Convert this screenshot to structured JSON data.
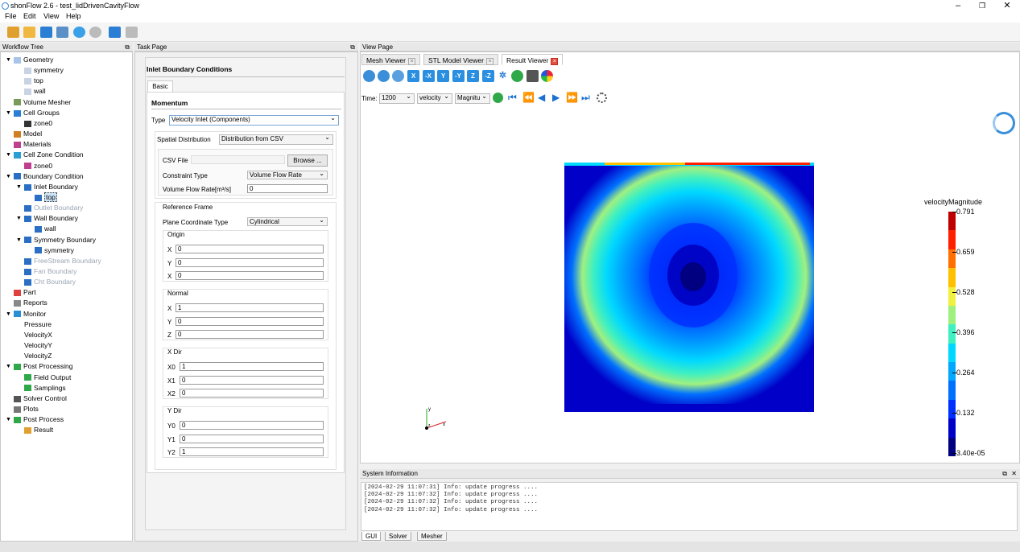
{
  "window": {
    "title": "shonFlow 2.6 - test_lidDrivenCavityFlow",
    "min": "–",
    "max": "❐",
    "close": "✕"
  },
  "menu": [
    "File",
    "Edit",
    "View",
    "Help"
  ],
  "panels": {
    "workflow": "Workflow Tree",
    "task": "Task Page",
    "view": "View Page",
    "sysinfo": "System Information",
    "float_icon": "⧉"
  },
  "tree": [
    {
      "label": "Geometry",
      "icon": "geometry",
      "expanded": true,
      "level": 0
    },
    {
      "label": "symmetry",
      "icon": "file",
      "level": 1
    },
    {
      "label": "top",
      "icon": "file",
      "level": 1
    },
    {
      "label": "wall",
      "icon": "file",
      "level": 1
    },
    {
      "label": "Volume Mesher",
      "icon": "mesher",
      "level": 0
    },
    {
      "label": "Cell Groups",
      "icon": "cellgroups",
      "expanded": true,
      "level": 0
    },
    {
      "label": "zone0",
      "icon": "zone",
      "level": 1
    },
    {
      "label": "Model",
      "icon": "model",
      "level": 0
    },
    {
      "label": "Materials",
      "icon": "materials",
      "level": 0
    },
    {
      "label": "Cell Zone Condition",
      "icon": "cellzone",
      "expanded": true,
      "level": 0
    },
    {
      "label": "zone0",
      "icon": "materials",
      "level": 1
    },
    {
      "label": "Boundary Condition",
      "icon": "boundary",
      "expanded": true,
      "level": 0
    },
    {
      "label": "Inlet Boundary",
      "icon": "boundary",
      "expanded": true,
      "level": 1
    },
    {
      "label": "top",
      "icon": "boundary",
      "level": 2,
      "selected": true
    },
    {
      "label": "Outlet Boundary",
      "icon": "boundary",
      "level": 1,
      "disabled": true
    },
    {
      "label": "Wall Boundary",
      "icon": "boundary",
      "expanded": true,
      "level": 1
    },
    {
      "label": "wall",
      "icon": "boundary",
      "level": 2
    },
    {
      "label": "Symmetry Boundary",
      "icon": "boundary",
      "expanded": true,
      "level": 1
    },
    {
      "label": "symmetry",
      "icon": "boundary",
      "level": 2
    },
    {
      "label": "FreeStream Boundary",
      "icon": "boundary",
      "level": 1,
      "disabled": true
    },
    {
      "label": "Fan Boundary",
      "icon": "boundary",
      "level": 1,
      "disabled": true
    },
    {
      "label": "Cht Boundary",
      "icon": "boundary",
      "level": 1,
      "disabled": true
    },
    {
      "label": "Part",
      "icon": "part",
      "level": 0
    },
    {
      "label": "Reports",
      "icon": "reports",
      "level": 0
    },
    {
      "label": "Monitor",
      "icon": "monitor",
      "expanded": true,
      "level": 0
    },
    {
      "label": "Pressure",
      "icon": "none",
      "level": 1
    },
    {
      "label": "VelocityX",
      "icon": "none",
      "level": 1
    },
    {
      "label": "VelocityY",
      "icon": "none",
      "level": 1
    },
    {
      "label": "VelocityZ",
      "icon": "none",
      "level": 1
    },
    {
      "label": "Post Processing",
      "icon": "post",
      "expanded": true,
      "level": 0
    },
    {
      "label": "Field Output",
      "icon": "post",
      "level": 1
    },
    {
      "label": "Samplings",
      "icon": "post",
      "level": 1
    },
    {
      "label": "Solver Control",
      "icon": "solver",
      "level": 0
    },
    {
      "label": "Plots",
      "icon": "plots",
      "level": 0
    },
    {
      "label": "Post Process",
      "icon": "post",
      "expanded": true,
      "level": 0
    },
    {
      "label": "Result",
      "icon": "result",
      "level": 1
    }
  ],
  "task": {
    "title": "Inlet Boundary Conditions",
    "tab": "Basic",
    "section": "Momentum",
    "type_label": "Type",
    "type_value": "Velocity Inlet (Components)",
    "spatial_label": "Spatial Distribution",
    "spatial_value": "Distribution from CSV",
    "csv_label": "CSV File",
    "csv_value": "",
    "browse": "Browse ...",
    "constraint_label": "Constraint Type",
    "constraint_value": "Volume Flow Rate",
    "vfr_label": "Volume Flow Rate[m³/s]",
    "vfr_value": "0",
    "ref_label": "Reference Frame",
    "plane_label": "Plane Coordinate Type",
    "plane_value": "Cylindrical",
    "origin": {
      "label": "Origin",
      "fields": [
        {
          "l": "X",
          "v": "0"
        },
        {
          "l": "Y",
          "v": "0"
        },
        {
          "l": "X",
          "v": "0"
        }
      ]
    },
    "normal": {
      "label": "Normal",
      "fields": [
        {
          "l": "X",
          "v": "1"
        },
        {
          "l": "Y",
          "v": "0"
        },
        {
          "l": "Z",
          "v": "0"
        }
      ]
    },
    "xdir": {
      "label": "X Dir",
      "fields": [
        {
          "l": "X0",
          "v": "1"
        },
        {
          "l": "X1",
          "v": "0"
        },
        {
          "l": "X2",
          "v": "0"
        }
      ]
    },
    "ydir": {
      "label": "Y Dir",
      "fields": [
        {
          "l": "Y0",
          "v": "0"
        },
        {
          "l": "Y1",
          "v": "0"
        },
        {
          "l": "Y2",
          "v": "1"
        }
      ]
    }
  },
  "view": {
    "tabs": [
      "Mesh Viewer",
      "STL Model Viewer",
      "Result Viewer"
    ],
    "axis_buttons": [
      "X",
      "-X",
      "Y",
      "-Y",
      "Z",
      "-Z"
    ],
    "time_label": "Time:",
    "time_value": "1200",
    "field_value": "velocity",
    "comp_value": "Magnitu",
    "legend_title": "velocityMagnitude",
    "legend_ticks": [
      "0.791",
      "0.659",
      "0.528",
      "0.396",
      "0.264",
      "0.132",
      "3.40e-05"
    ],
    "colors": [
      "#000080",
      "#0000c8",
      "#0030ff",
      "#0070ff",
      "#00a8ff",
      "#00d8ff",
      "#40f0c0",
      "#a0f080",
      "#f0f040",
      "#ffc000",
      "#ff7000",
      "#ff2000",
      "#c00000"
    ],
    "axes": {
      "x": "x",
      "y": "y",
      "z": "z"
    }
  },
  "sysinfo": {
    "lines": [
      "[2024-02-29 11:07:31] Info: update progress ....",
      "[2024-02-29 11:07:32] Info: update progress ....",
      "[2024-02-29 11:07:32] Info: update progress ....",
      "[2024-02-29 11:07:32] Info: update progress ...."
    ],
    "tabs": [
      "GUI",
      "Solver",
      "Mesher"
    ]
  }
}
